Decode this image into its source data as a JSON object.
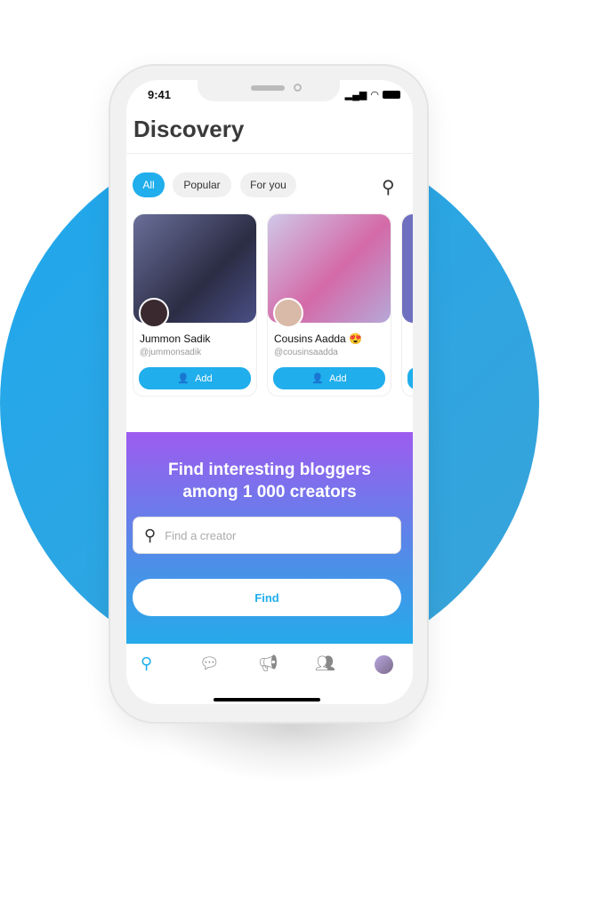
{
  "status_bar": {
    "time": "9:41"
  },
  "header": {
    "title": "Discovery"
  },
  "filters": [
    {
      "label": "All",
      "active": true
    },
    {
      "label": "Popular"
    },
    {
      "label": "For you"
    }
  ],
  "creators": [
    {
      "name": "Jummon Sadik",
      "handle": "@jummonsadik",
      "add_label": "Add"
    },
    {
      "name": "Cousins Aadda 😍",
      "handle": "@cousinsaadda",
      "add_label": "Add"
    }
  ],
  "promo": {
    "title": "Find interesting bloggers among 1 000 creators",
    "search_placeholder": "Find a creator",
    "find_label": "Find"
  },
  "tabbar": {
    "items": [
      "search-icon",
      "chat-icon",
      "megaphone-icon",
      "people-icon",
      "profile-avatar"
    ],
    "active": "search-icon"
  },
  "colors": {
    "accent": "#20aeec",
    "gradient_top": "#9d5cef",
    "gradient_bottom": "#26aaea"
  }
}
